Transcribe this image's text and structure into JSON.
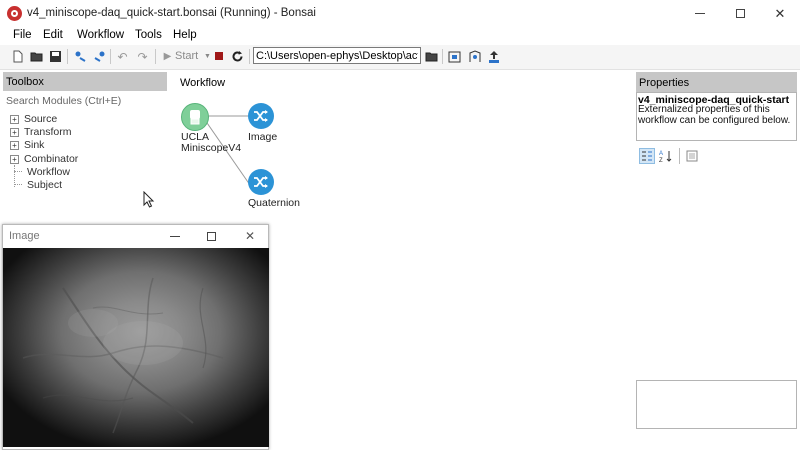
{
  "window": {
    "title": "v4_miniscope-daq_quick-start.bonsai (Running) - Bonsai",
    "controls": {
      "minimize": "minimize",
      "maximize": "maximize",
      "close": "close"
    }
  },
  "menu": {
    "items": [
      "File",
      "Edit",
      "Workflow",
      "Tools",
      "Help"
    ]
  },
  "toolbar": {
    "start_label": "Start",
    "path_value": "C:\\Users\\open-ephys\\Desktop\\active"
  },
  "toolbox": {
    "title": "Toolbox",
    "search_placeholder": "Search Modules (Ctrl+E)",
    "categories": [
      {
        "label": "Source",
        "expandable": true
      },
      {
        "label": "Transform",
        "expandable": true
      },
      {
        "label": "Sink",
        "expandable": true
      },
      {
        "label": "Combinator",
        "expandable": true
      },
      {
        "label": "Workflow",
        "expandable": false
      },
      {
        "label": "Subject",
        "expandable": false
      }
    ]
  },
  "workflow": {
    "title": "Workflow",
    "nodes": [
      {
        "label_line1": "UCLA",
        "label_line2": "MiniscopeV4",
        "color": "#7fcf99"
      },
      {
        "label": "Image",
        "color": "#2c93d6"
      },
      {
        "label": "Quaternion",
        "color": "#2c93d6"
      }
    ]
  },
  "properties": {
    "title": "Properties",
    "object_name": "v4_miniscope-daq_quick-start",
    "description": "Externalized properties of this workflow can be configured below."
  },
  "image_window": {
    "title": "Image"
  },
  "colors": {
    "accent_blue": "#2c93d6",
    "source_green": "#7fcf99",
    "stop_red": "#a01818",
    "panel_header": "#c6c6c6"
  }
}
